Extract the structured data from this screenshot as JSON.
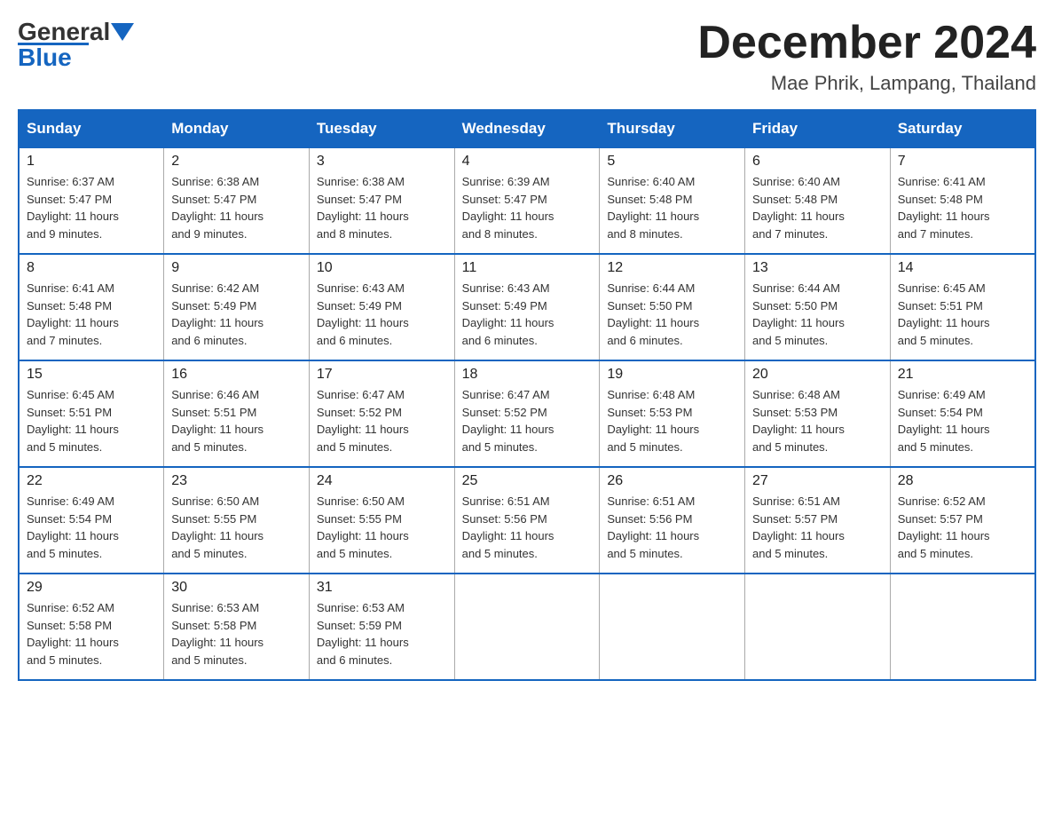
{
  "header": {
    "logo_general": "General",
    "logo_blue": "Blue",
    "month_title": "December 2024",
    "location": "Mae Phrik, Lampang, Thailand"
  },
  "days_of_week": [
    "Sunday",
    "Monday",
    "Tuesday",
    "Wednesday",
    "Thursday",
    "Friday",
    "Saturday"
  ],
  "weeks": [
    [
      {
        "day": "1",
        "sunrise": "6:37 AM",
        "sunset": "5:47 PM",
        "daylight": "11 hours and 9 minutes."
      },
      {
        "day": "2",
        "sunrise": "6:38 AM",
        "sunset": "5:47 PM",
        "daylight": "11 hours and 9 minutes."
      },
      {
        "day": "3",
        "sunrise": "6:38 AM",
        "sunset": "5:47 PM",
        "daylight": "11 hours and 8 minutes."
      },
      {
        "day": "4",
        "sunrise": "6:39 AM",
        "sunset": "5:47 PM",
        "daylight": "11 hours and 8 minutes."
      },
      {
        "day": "5",
        "sunrise": "6:40 AM",
        "sunset": "5:48 PM",
        "daylight": "11 hours and 8 minutes."
      },
      {
        "day": "6",
        "sunrise": "6:40 AM",
        "sunset": "5:48 PM",
        "daylight": "11 hours and 7 minutes."
      },
      {
        "day": "7",
        "sunrise": "6:41 AM",
        "sunset": "5:48 PM",
        "daylight": "11 hours and 7 minutes."
      }
    ],
    [
      {
        "day": "8",
        "sunrise": "6:41 AM",
        "sunset": "5:48 PM",
        "daylight": "11 hours and 7 minutes."
      },
      {
        "day": "9",
        "sunrise": "6:42 AM",
        "sunset": "5:49 PM",
        "daylight": "11 hours and 6 minutes."
      },
      {
        "day": "10",
        "sunrise": "6:43 AM",
        "sunset": "5:49 PM",
        "daylight": "11 hours and 6 minutes."
      },
      {
        "day": "11",
        "sunrise": "6:43 AM",
        "sunset": "5:49 PM",
        "daylight": "11 hours and 6 minutes."
      },
      {
        "day": "12",
        "sunrise": "6:44 AM",
        "sunset": "5:50 PM",
        "daylight": "11 hours and 6 minutes."
      },
      {
        "day": "13",
        "sunrise": "6:44 AM",
        "sunset": "5:50 PM",
        "daylight": "11 hours and 5 minutes."
      },
      {
        "day": "14",
        "sunrise": "6:45 AM",
        "sunset": "5:51 PM",
        "daylight": "11 hours and 5 minutes."
      }
    ],
    [
      {
        "day": "15",
        "sunrise": "6:45 AM",
        "sunset": "5:51 PM",
        "daylight": "11 hours and 5 minutes."
      },
      {
        "day": "16",
        "sunrise": "6:46 AM",
        "sunset": "5:51 PM",
        "daylight": "11 hours and 5 minutes."
      },
      {
        "day": "17",
        "sunrise": "6:47 AM",
        "sunset": "5:52 PM",
        "daylight": "11 hours and 5 minutes."
      },
      {
        "day": "18",
        "sunrise": "6:47 AM",
        "sunset": "5:52 PM",
        "daylight": "11 hours and 5 minutes."
      },
      {
        "day": "19",
        "sunrise": "6:48 AM",
        "sunset": "5:53 PM",
        "daylight": "11 hours and 5 minutes."
      },
      {
        "day": "20",
        "sunrise": "6:48 AM",
        "sunset": "5:53 PM",
        "daylight": "11 hours and 5 minutes."
      },
      {
        "day": "21",
        "sunrise": "6:49 AM",
        "sunset": "5:54 PM",
        "daylight": "11 hours and 5 minutes."
      }
    ],
    [
      {
        "day": "22",
        "sunrise": "6:49 AM",
        "sunset": "5:54 PM",
        "daylight": "11 hours and 5 minutes."
      },
      {
        "day": "23",
        "sunrise": "6:50 AM",
        "sunset": "5:55 PM",
        "daylight": "11 hours and 5 minutes."
      },
      {
        "day": "24",
        "sunrise": "6:50 AM",
        "sunset": "5:55 PM",
        "daylight": "11 hours and 5 minutes."
      },
      {
        "day": "25",
        "sunrise": "6:51 AM",
        "sunset": "5:56 PM",
        "daylight": "11 hours and 5 minutes."
      },
      {
        "day": "26",
        "sunrise": "6:51 AM",
        "sunset": "5:56 PM",
        "daylight": "11 hours and 5 minutes."
      },
      {
        "day": "27",
        "sunrise": "6:51 AM",
        "sunset": "5:57 PM",
        "daylight": "11 hours and 5 minutes."
      },
      {
        "day": "28",
        "sunrise": "6:52 AM",
        "sunset": "5:57 PM",
        "daylight": "11 hours and 5 minutes."
      }
    ],
    [
      {
        "day": "29",
        "sunrise": "6:52 AM",
        "sunset": "5:58 PM",
        "daylight": "11 hours and 5 minutes."
      },
      {
        "day": "30",
        "sunrise": "6:53 AM",
        "sunset": "5:58 PM",
        "daylight": "11 hours and 5 minutes."
      },
      {
        "day": "31",
        "sunrise": "6:53 AM",
        "sunset": "5:59 PM",
        "daylight": "11 hours and 6 minutes."
      },
      null,
      null,
      null,
      null
    ]
  ],
  "labels": {
    "sunrise": "Sunrise:",
    "sunset": "Sunset:",
    "daylight": "Daylight:"
  }
}
